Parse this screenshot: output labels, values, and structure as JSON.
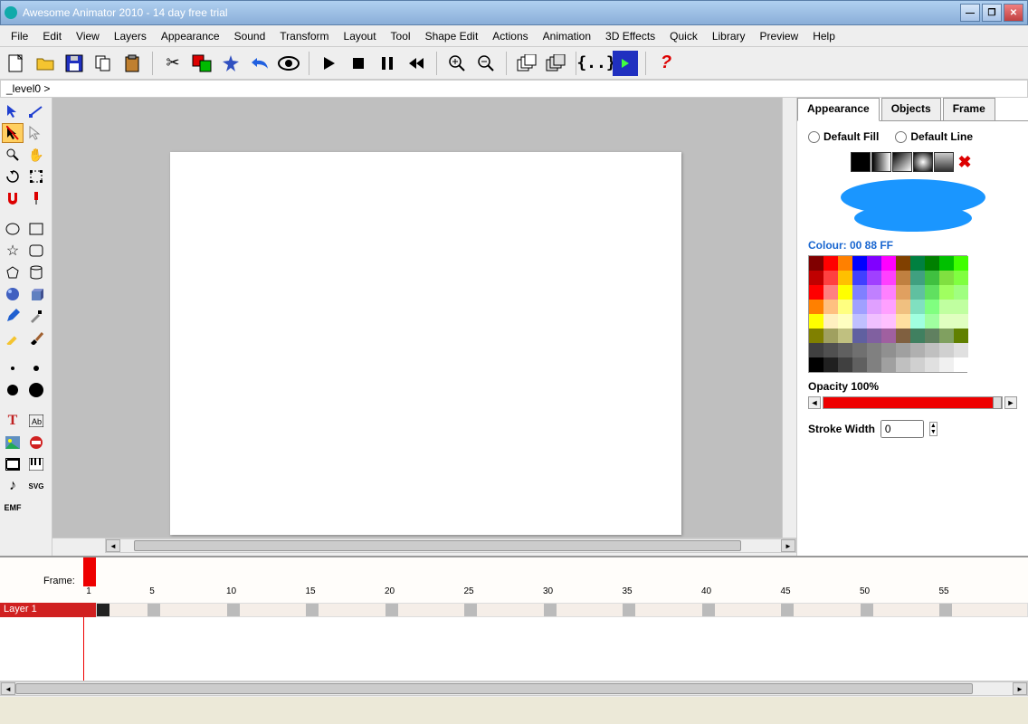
{
  "window": {
    "title": "Awesome Animator 2010 - 14 day free trial"
  },
  "menu": {
    "items": [
      "File",
      "Edit",
      "View",
      "Layers",
      "Appearance",
      "Sound",
      "Transform",
      "Layout",
      "Tool",
      "Shape Edit",
      "Actions",
      "Animation",
      "3D Effects",
      "Quick",
      "Library",
      "Preview",
      "Help"
    ]
  },
  "breadcrumb": {
    "path": "_level0 >"
  },
  "toolbar": {
    "new": "",
    "open": "",
    "save": "",
    "copy": "",
    "paste": "",
    "cut": "",
    "fill_swap": "",
    "blob": "",
    "undo": "",
    "preview": "",
    "play": "",
    "stop": "",
    "pause": "",
    "rewind": "",
    "zoom_in": "",
    "zoom_out": "",
    "dup1": "",
    "dup2": "",
    "braces": "{..}",
    "exec": "",
    "help": "?"
  },
  "panel": {
    "tabs": [
      "Appearance",
      "Objects",
      "Frame"
    ],
    "active_tab": "Appearance",
    "default_fill": "Default Fill",
    "default_line": "Default Line",
    "colour_label": "Colour: 00 88 FF",
    "opacity_label": "Opacity  100%",
    "stroke_label": "Stroke Width",
    "stroke_value": "0"
  },
  "palette_colors": [
    "#800000",
    "#f00",
    "#ff8000",
    "#00f",
    "#8000ff",
    "#ff00ff",
    "#804000",
    "#008040",
    "#008000",
    "#00c000",
    "#40ff00",
    "#c00000",
    "#ff4040",
    "#ffc000",
    "#4040ff",
    "#a040ff",
    "#ff40ff",
    "#c08040",
    "#40a080",
    "#40c040",
    "#80e040",
    "#80ff40",
    "#ff0000",
    "#ff8080",
    "#ffff00",
    "#8080ff",
    "#c080ff",
    "#ff80ff",
    "#e0a060",
    "#60c0a0",
    "#60e060",
    "#a0ff60",
    "#a0ff80",
    "#ff8000",
    "#ffc080",
    "#ffff80",
    "#a0a0ff",
    "#e0a0ff",
    "#ffa0ff",
    "#f0c080",
    "#80e0c0",
    "#80ff80",
    "#c0ffa0",
    "#c0ffa0",
    "#ffff00",
    "#fff0c0",
    "#ffffc0",
    "#c0c0ff",
    "#f0c0ff",
    "#ffc0ff",
    "#ffe0a0",
    "#a0ffe0",
    "#a0ffa0",
    "#e0ffc0",
    "#e0ffc0",
    "#808000",
    "#a0a060",
    "#c0c080",
    "#6060a0",
    "#8060a0",
    "#a060a0",
    "#806040",
    "#408060",
    "#608060",
    "#80a060",
    "#608000",
    "#404040",
    "#505050",
    "#606060",
    "#707070",
    "#808080",
    "#909090",
    "#a0a0a0",
    "#b0b0b0",
    "#c0c0c0",
    "#d0d0d0",
    "#e0e0e0",
    "#000",
    "#202020",
    "#404040",
    "#606060",
    "#808080",
    "#a0a0a0",
    "#c0c0c0",
    "#d0d0d0",
    "#e0e0e0",
    "#f0f0f0",
    "#fff"
  ],
  "timeline": {
    "frame_label": "Frame:",
    "layer1": "Layer 1",
    "ruler": [
      1,
      5,
      10,
      15,
      20,
      25,
      30,
      35,
      40,
      45,
      50,
      55
    ]
  }
}
